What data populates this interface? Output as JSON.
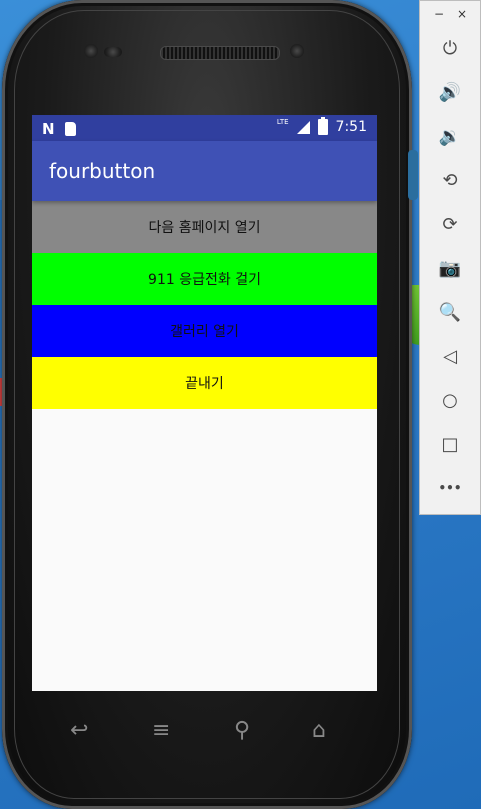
{
  "app": {
    "title": "fourbutton"
  },
  "statusbar": {
    "notification_icon": "N",
    "lte": "LTE",
    "time": "7:51"
  },
  "buttons": [
    {
      "label": "다음 홈페이지 열기",
      "color": "#888888"
    },
    {
      "label": "911 응급전화 걸기",
      "color": "#00ff00"
    },
    {
      "label": "갤러리 열기",
      "color": "#0000ff"
    },
    {
      "label": "끝내기",
      "color": "#ffff00"
    }
  ],
  "emulator_toolbar": {
    "minimize": "−",
    "close": "×",
    "tools": [
      {
        "name": "power-icon",
        "glyph": "⏻"
      },
      {
        "name": "volume-up-icon",
        "glyph": "🔊"
      },
      {
        "name": "volume-down-icon",
        "glyph": "🔉"
      },
      {
        "name": "rotate-left-icon",
        "glyph": "⟲"
      },
      {
        "name": "rotate-right-icon",
        "glyph": "⟳"
      },
      {
        "name": "camera-icon",
        "glyph": "📷"
      },
      {
        "name": "zoom-icon",
        "glyph": "🔍"
      },
      {
        "name": "back-icon",
        "glyph": "◁"
      },
      {
        "name": "home-icon",
        "glyph": "○"
      },
      {
        "name": "overview-icon",
        "glyph": "□"
      },
      {
        "name": "more-icon",
        "glyph": "•••"
      }
    ]
  },
  "phone_keys": {
    "back": "↩",
    "menu": "≡",
    "search": "⚲",
    "home": "⌂"
  }
}
